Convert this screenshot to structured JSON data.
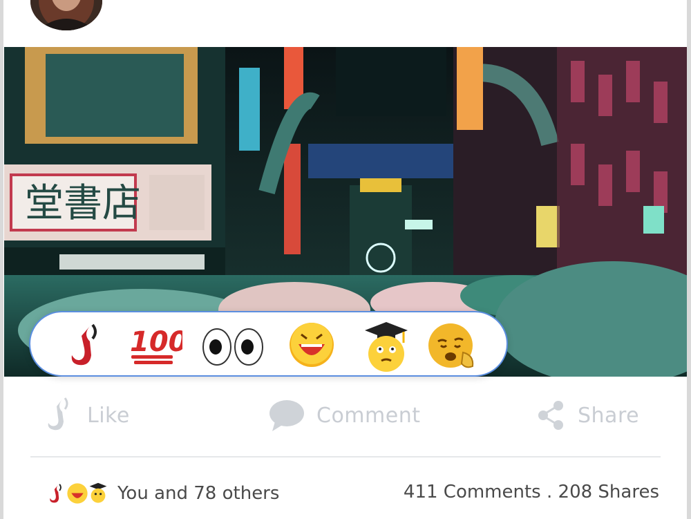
{
  "post": {
    "image_alt": "Neon-lit street at night with umbrellas"
  },
  "reactions": [
    {
      "name": "j-logo",
      "label": "J"
    },
    {
      "name": "hundred",
      "label": "100"
    },
    {
      "name": "eyes",
      "label": "eyes"
    },
    {
      "name": "laughing",
      "label": "laughing"
    },
    {
      "name": "graduate",
      "label": "graduate"
    },
    {
      "name": "thinking",
      "label": "thinking"
    }
  ],
  "actions": {
    "like_label": "Like",
    "comment_label": "Comment",
    "share_label": "Share"
  },
  "summary": {
    "reacted_text": "You and 78 others",
    "comments_shares_text": "411 Comments . 208 Shares"
  },
  "colors": {
    "reaction_border": "#5b8ee0",
    "action_text": "#c9cdd3",
    "summary_text": "#4a4a4a",
    "brand_red": "#c8202a"
  }
}
